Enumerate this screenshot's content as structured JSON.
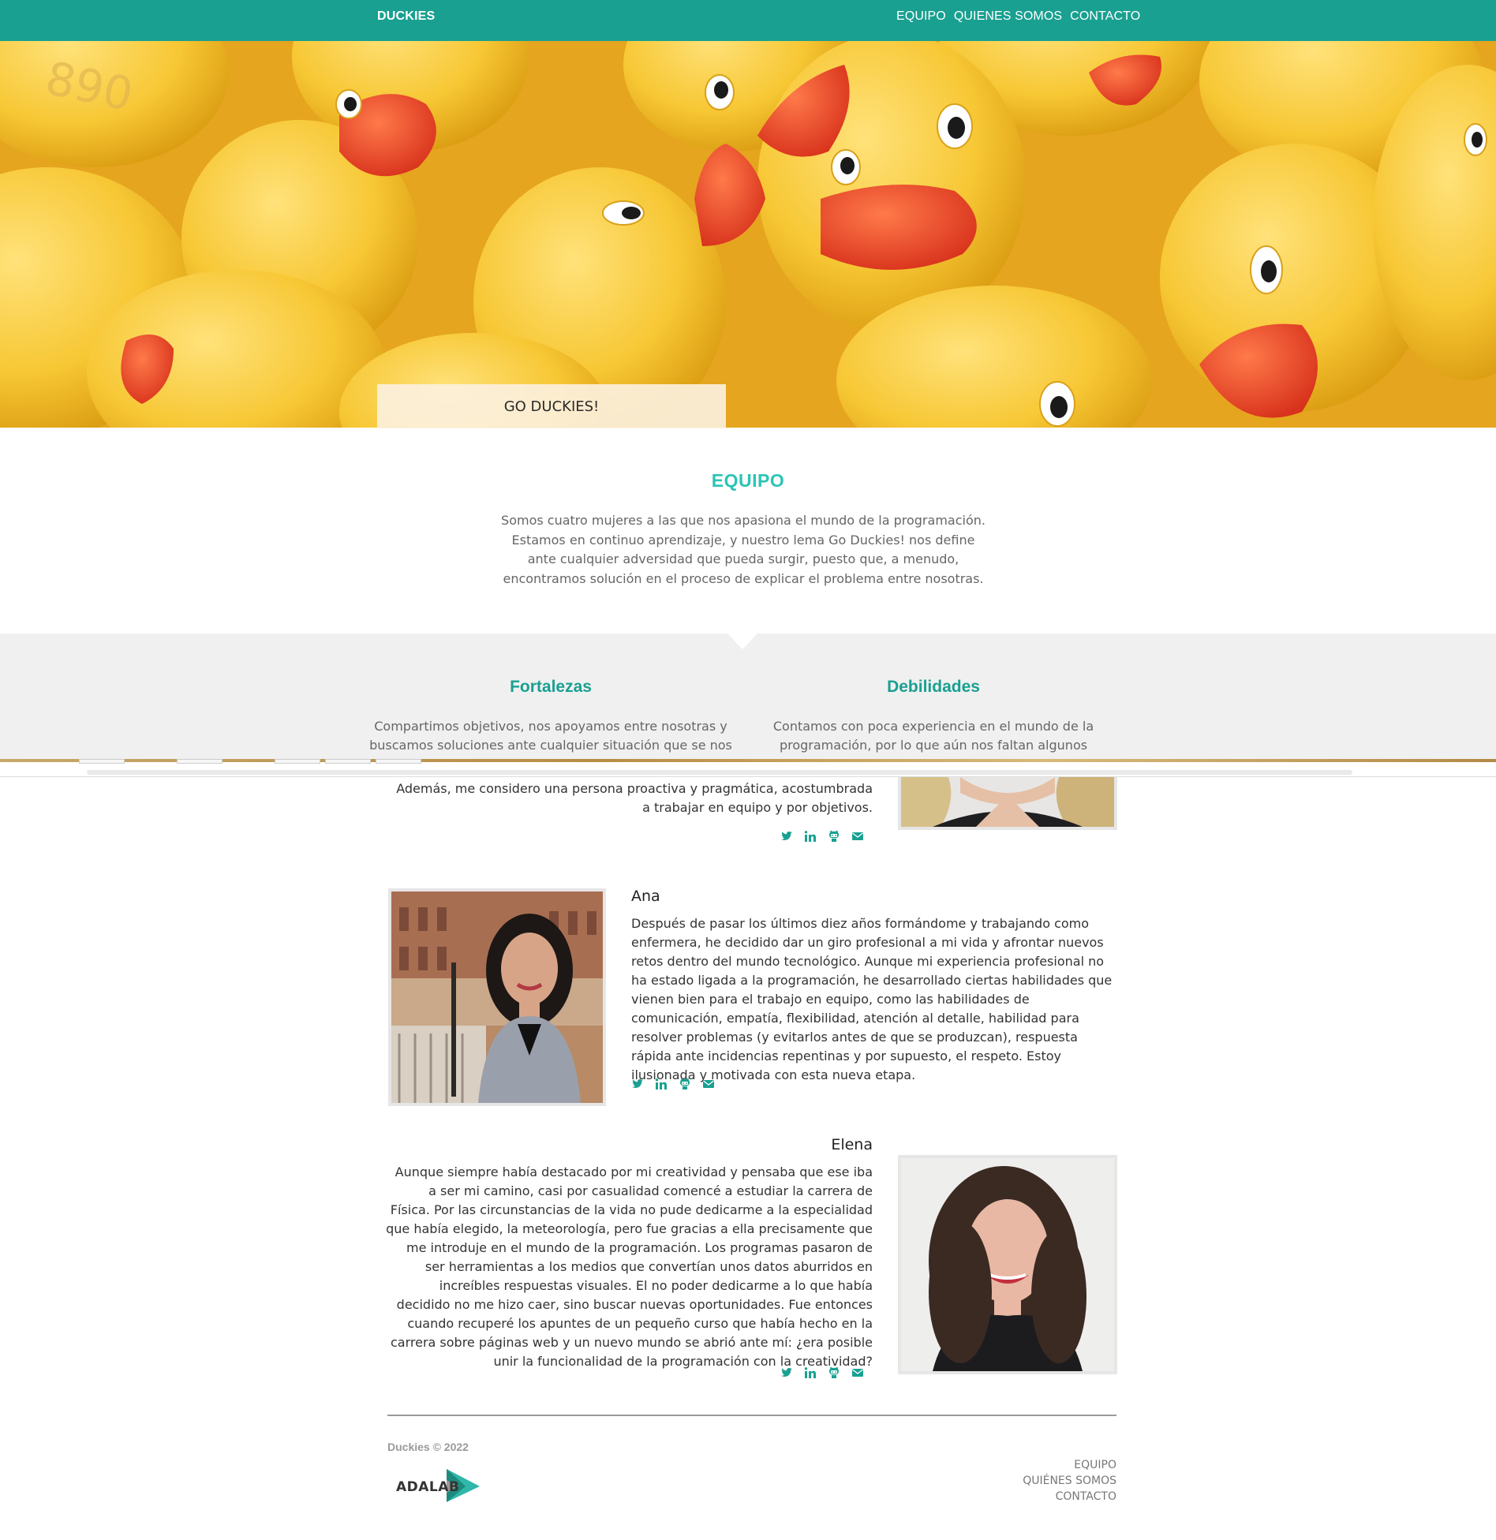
{
  "header": {
    "brand": "DUCKIES",
    "nav": [
      "EQUIPO",
      "QUIENES SOMOS",
      "CONTACTO"
    ]
  },
  "hero": {
    "caption": "GO DUCKIES!",
    "background_number": "890"
  },
  "equipo": {
    "title": "EQUIPO",
    "text": "Somos cuatro mujeres a las que nos apasiona el mundo de la programación. Estamos en continuo aprendizaje, y nuestro lema Go Duckies! nos define ante cualquier adversidad que pueda surgir, puesto que, a menudo, encontramos solución en el proceso de explicar el problema entre nosotras."
  },
  "strengths": {
    "title": "Fortalezas",
    "text": "Compartimos objetivos, nos apoyamos entre nosotras y buscamos soluciones ante cualquier situación que se nos"
  },
  "weaknesses": {
    "title": "Debilidades",
    "text": "Contamos con poca experiencia en el mundo de la programación, por lo que aún nos faltan algunos"
  },
  "members": [
    {
      "name": "",
      "text": "Además, me considero una persona proactiva y pragmática, acostumbrada a trabajar en equipo y por objetivos."
    },
    {
      "name": "Ana",
      "text": "Después de pasar los últimos diez años formándome y trabajando como enfermera, he decidido dar un giro profesional a mi vida y afrontar nuevos retos dentro del mundo tecnológico. Aunque mi experiencia profesional no ha estado ligada a la programación, he desarrollado ciertas habilidades que vienen bien para el trabajo en equipo, como las habilidades de comunicación, empatía, flexibilidad, atención al detalle, habilidad para resolver problemas (y evitarlos antes de que se produzcan), respuesta rápida ante incidencias repentinas y por supuesto, el respeto. Estoy ilusionada y motivada con esta nueva etapa."
    },
    {
      "name": "Elena",
      "text": "Aunque siempre había destacado por mi creatividad y pensaba que ese iba a ser mi camino, casi por casualidad comencé a estudiar la carrera de Física. Por las circunstancias de la vida no pude dedicarme a la especialidad que había elegido, la meteorología, pero fue gracias a ella precisamente que me introduje en el mundo de la programación. Los programas pasaron de ser herramientas a los medios que convertían unos datos aburridos en increíbles respuestas visuales. El no poder dedicarme a lo que había decidido no me hizo caer, sino buscar nuevas oportunidades. Fue entonces cuando recuperé los apuntes de un pequeño curso que había hecho en la carrera sobre páginas web y un nuevo mundo se abrió ante mí: ¿era posible unir la funcionalidad de la programación con la creatividad?"
    }
  ],
  "social_icons": [
    "twitter-icon",
    "linkedin-icon",
    "github-icon",
    "email-icon"
  ],
  "footer": {
    "copyright": "Duckies © 2022",
    "logo_text": "ADALAB",
    "links": [
      "EQUIPO",
      "QUIÉNES SOMOS",
      "CONTACTO"
    ]
  },
  "colors": {
    "teal": "#19a091",
    "accent": "#2cc4b4",
    "panel": "#f0f0f0"
  }
}
